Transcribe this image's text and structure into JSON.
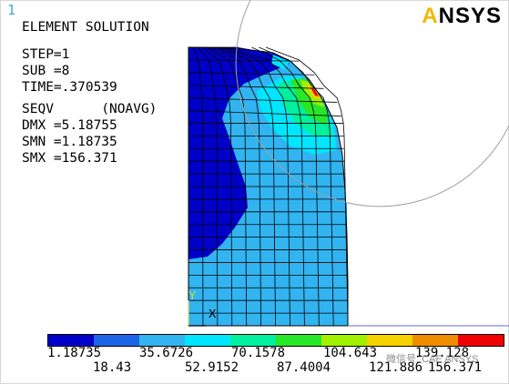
{
  "window_number": "1",
  "logo": {
    "text": "ANSYS"
  },
  "info_lines": [
    "ELEMENT SOLUTION",
    "STEP=1",
    "SUB =8",
    "TIME=.370539",
    "SEQV      (NOAVG)",
    "DMX =5.18755",
    "SMN =1.18735",
    "SMX =156.371"
  ],
  "legend": {
    "colors": [
      "#0000c8",
      "#1e64e6",
      "#32b4f0",
      "#00e6ff",
      "#00f0a0",
      "#28e628",
      "#a0f000",
      "#f5d200",
      "#f08c00",
      "#f00000"
    ],
    "labels_top": [
      "1.18735",
      "35.6726",
      "70.1578",
      "104.643",
      "139.128"
    ],
    "labels_bottom": [
      "18.43",
      "52.9152",
      "87.4004",
      "121.886",
      "156.371"
    ]
  },
  "axis": {
    "y": "Y",
    "x": "X"
  },
  "watermark": "微信号: CAE ANSYS",
  "colors": {
    "window_number": "#3fa9e6",
    "mesh_line": "#000000",
    "contact_arc": "#a0a0a0",
    "axis_y": "#e0e060",
    "axis_x": "#000000"
  }
}
